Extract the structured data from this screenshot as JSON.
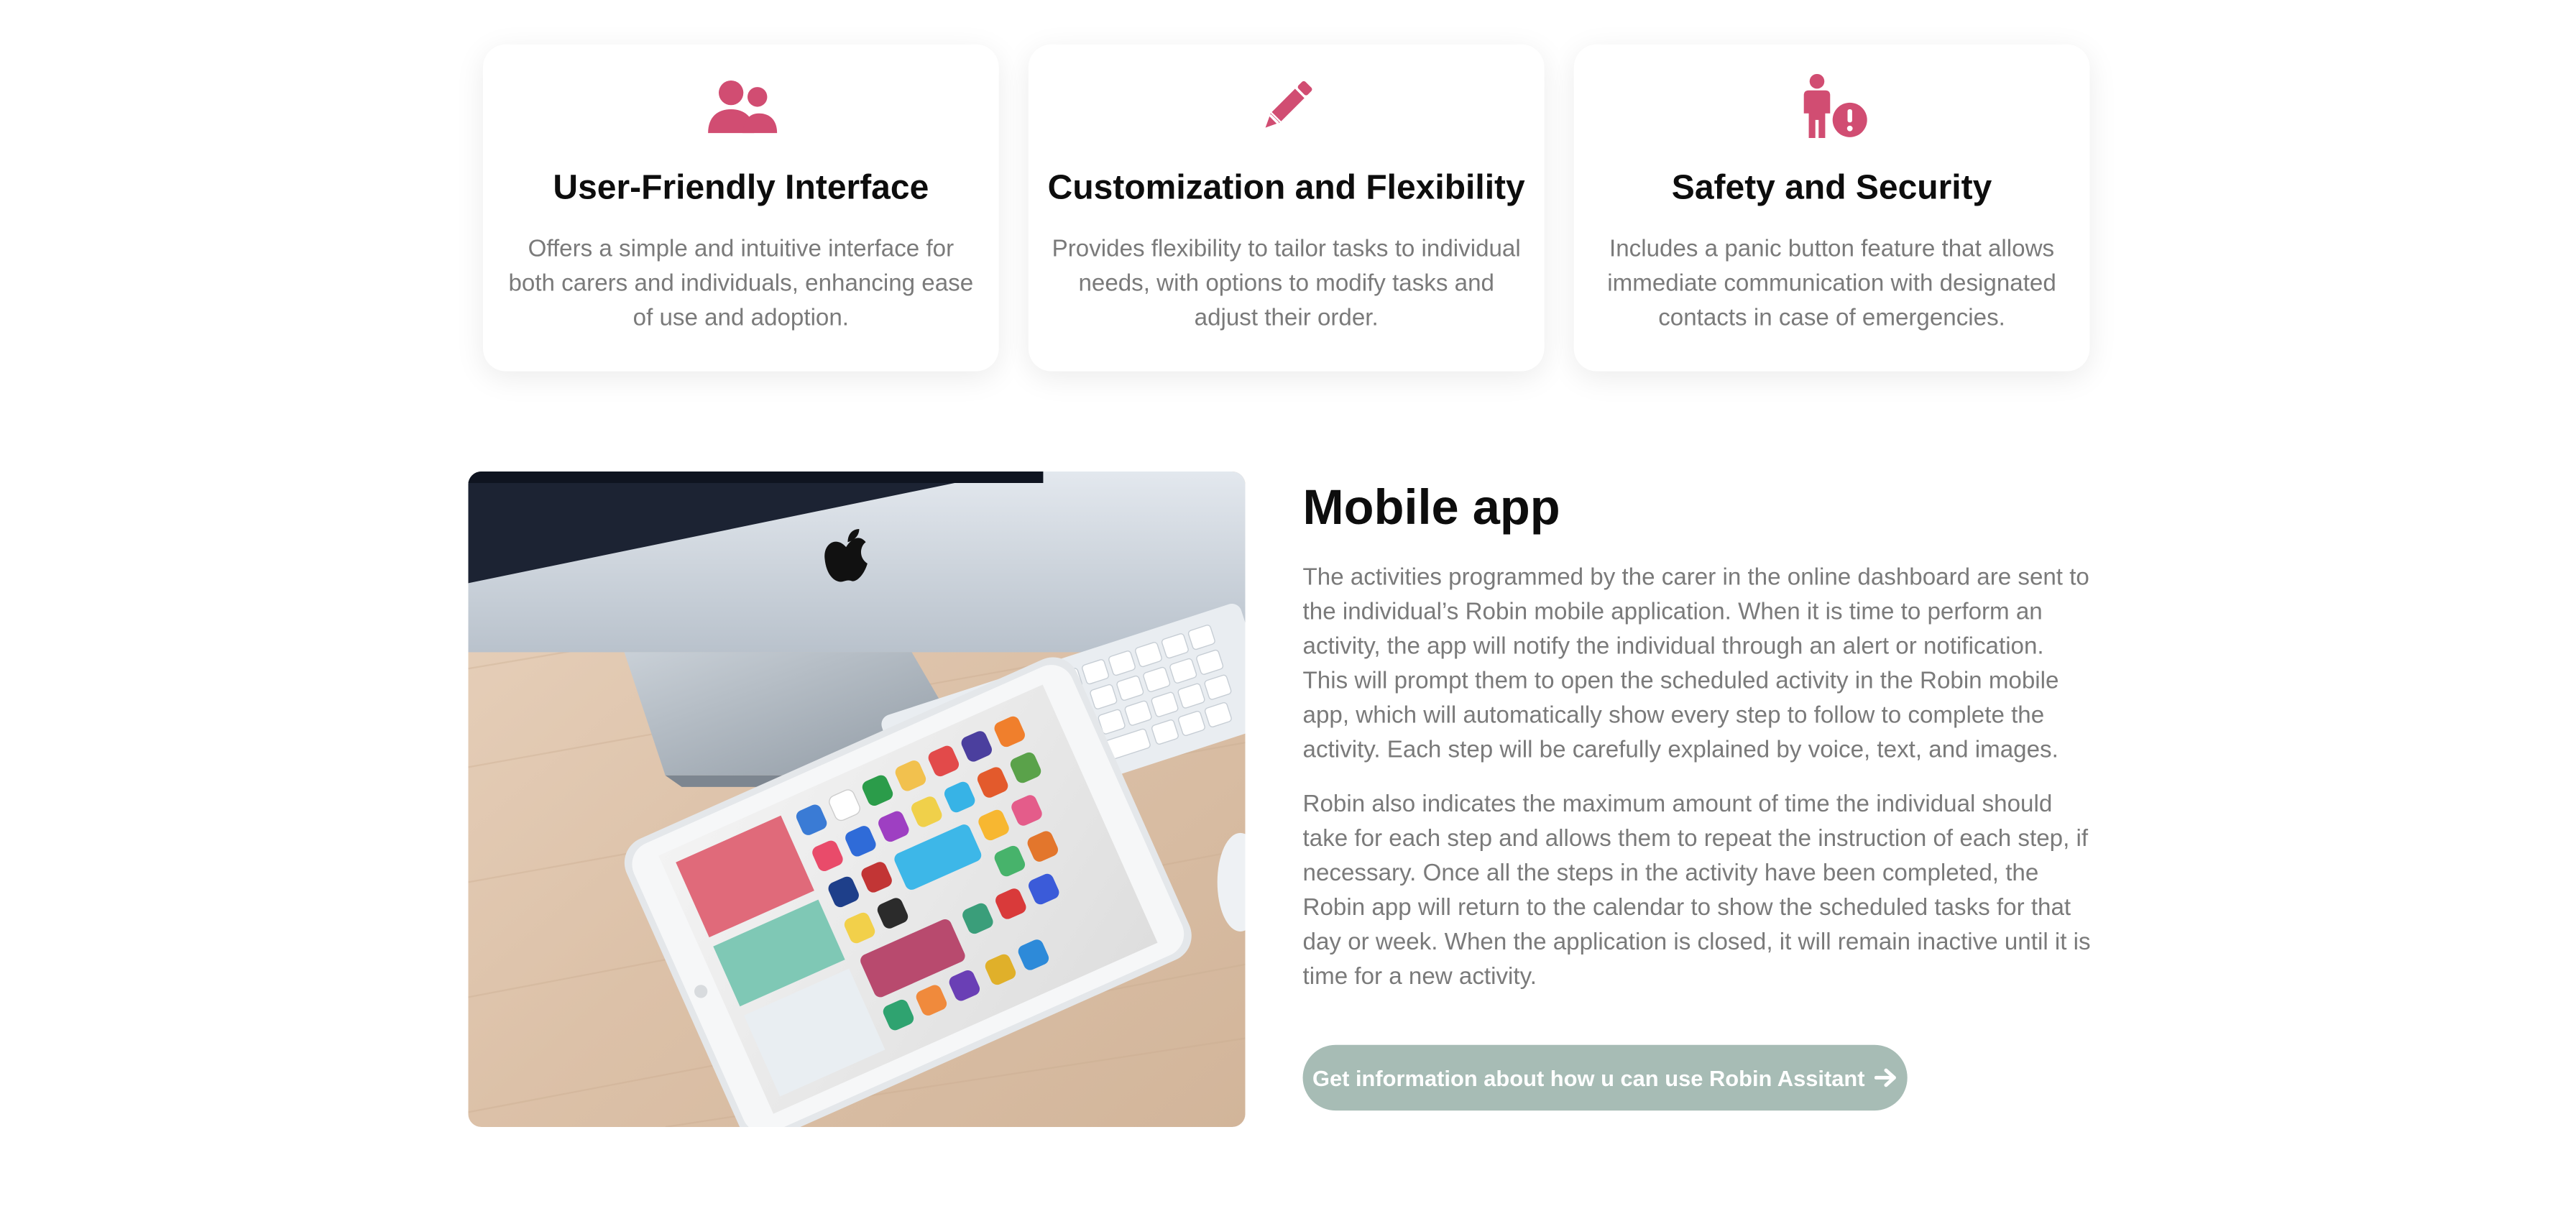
{
  "colors": {
    "icon_accent": "#d14d72",
    "button_bg": "#a7bcb5",
    "body_text": "#7a7a7a",
    "heading_text": "#0d0d0d"
  },
  "features": [
    {
      "icon": "users-icon",
      "title": "User-Friendly Interface",
      "description": "Offers a simple and intuitive interface for both carers and individuals, enhancing ease of use and adoption."
    },
    {
      "icon": "pencil-icon",
      "title": "Customization and Flexibility",
      "description": "Provides flexibility to tailor tasks to individual needs, with options to modify tasks and adjust their order."
    },
    {
      "icon": "person-alert-icon",
      "title": "Safety and Security",
      "description": "Includes a panic button feature that allows immediate communication with designated contacts in case of emergencies."
    }
  ],
  "mobile_app": {
    "image": "desk-imac-ipad-photo",
    "title": "Mobile app",
    "paragraphs": [
      "The activities programmed by the carer in the online dashboard are sent to the individual’s Robin mobile application. When it is time to perform an activity, the app will notify the individual through an alert or notification. This will prompt them to open the scheduled activity in the Robin mobile app, which will automatically show every step to follow to complete the activity. Each step will be carefully explained by voice, text, and images.",
      "Robin also indicates the maximum amount of time the individual should take for each step and allows them to repeat the instruction of each step, if necessary. Once all the steps in the activity have been completed, the Robin app will return to the calendar to show the scheduled tasks for that day or week. When the application is closed, it will remain inactive until it is time for a new activity."
    ],
    "cta_label": "Get information about how u can use Robin Assitant",
    "cta_icon": "arrow-right-icon"
  }
}
